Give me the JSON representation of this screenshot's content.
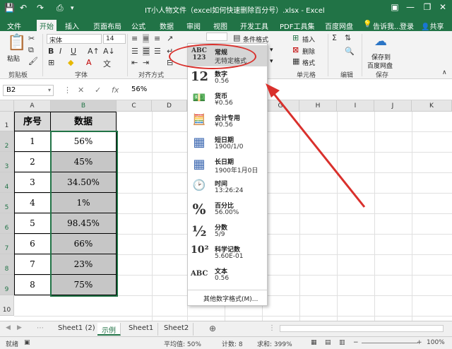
{
  "window": {
    "title": "IT小人物文件（excel如何快速删除百分号）.xlsx - Excel",
    "min": "—",
    "restore": "❐",
    "close": "✕"
  },
  "ribbon_tabs": [
    "文件",
    "开始",
    "插入",
    "页面布局",
    "公式",
    "数据",
    "审阅",
    "视图",
    "开发工具",
    "PDF工具集",
    "百度网盘"
  ],
  "tell_me": "告诉我...",
  "login": "登录",
  "share": "共享",
  "ribbon": {
    "paste": "粘贴",
    "clipboard": "剪贴板",
    "font_name": "宋体",
    "font_size": "14",
    "font_group": "字体",
    "align_group": "对齐方式",
    "cond_format": "条件格式",
    "insert": "插入",
    "delete": "删除",
    "format": "格式",
    "cells_group": "单元格",
    "edit_group": "编辑",
    "save_to_baidu": "保存到",
    "save_to_baidu2": "百度网盘",
    "save_group": "保存"
  },
  "formula_bar": {
    "name_box": "B2",
    "value": "56%"
  },
  "columns": [
    "A",
    "B",
    "C",
    "D",
    "E",
    "F",
    "G",
    "H",
    "I",
    "J",
    "K"
  ],
  "rows": [
    "1",
    "2",
    "3",
    "4",
    "5",
    "6",
    "7",
    "8",
    "9",
    "10"
  ],
  "table": {
    "headers": [
      "序号",
      "数据"
    ],
    "rows": [
      [
        "1",
        "56%"
      ],
      [
        "2",
        "45%"
      ],
      [
        "3",
        "34.50%"
      ],
      [
        "4",
        "1%"
      ],
      [
        "5",
        "98.45%"
      ],
      [
        "6",
        "66%"
      ],
      [
        "7",
        "23%"
      ],
      [
        "8",
        "75%"
      ]
    ]
  },
  "number_format_menu": {
    "items": [
      {
        "icon": "ABC\n123",
        "name": "常规",
        "example": "无特定格式"
      },
      {
        "icon": "12",
        "name": "数字",
        "example": "0.56"
      },
      {
        "icon": "💵",
        "name": "货币",
        "example": "¥0.56"
      },
      {
        "icon": "🧮",
        "name": "会计专用",
        "example": " ¥0.56"
      },
      {
        "icon": "▦",
        "name": "短日期",
        "example": "1900/1/0"
      },
      {
        "icon": "▦",
        "name": "长日期",
        "example": "1900年1月0日"
      },
      {
        "icon": "🕑",
        "name": "时间",
        "example": "13:26:24"
      },
      {
        "icon": "%",
        "name": "百分比",
        "example": "56.00%"
      },
      {
        "icon": "½",
        "name": "分数",
        "example": "5/9"
      },
      {
        "icon": "10²",
        "name": "科学记数",
        "example": "5.60E-01"
      },
      {
        "icon": "ABC",
        "name": "文本",
        "example": "0.56"
      }
    ],
    "more": "其他数字格式(M)..."
  },
  "sheets": [
    "Sheet1 (2)",
    "示例",
    "Sheet1",
    "Sheet2"
  ],
  "status": {
    "ready": "就绪",
    "average": "平均值: 50%",
    "count": "计数: 8",
    "sum": "求和: 399%",
    "zoom": "100%"
  },
  "colors": {
    "excel_green": "#217346",
    "highlight_red": "#d9302c"
  }
}
